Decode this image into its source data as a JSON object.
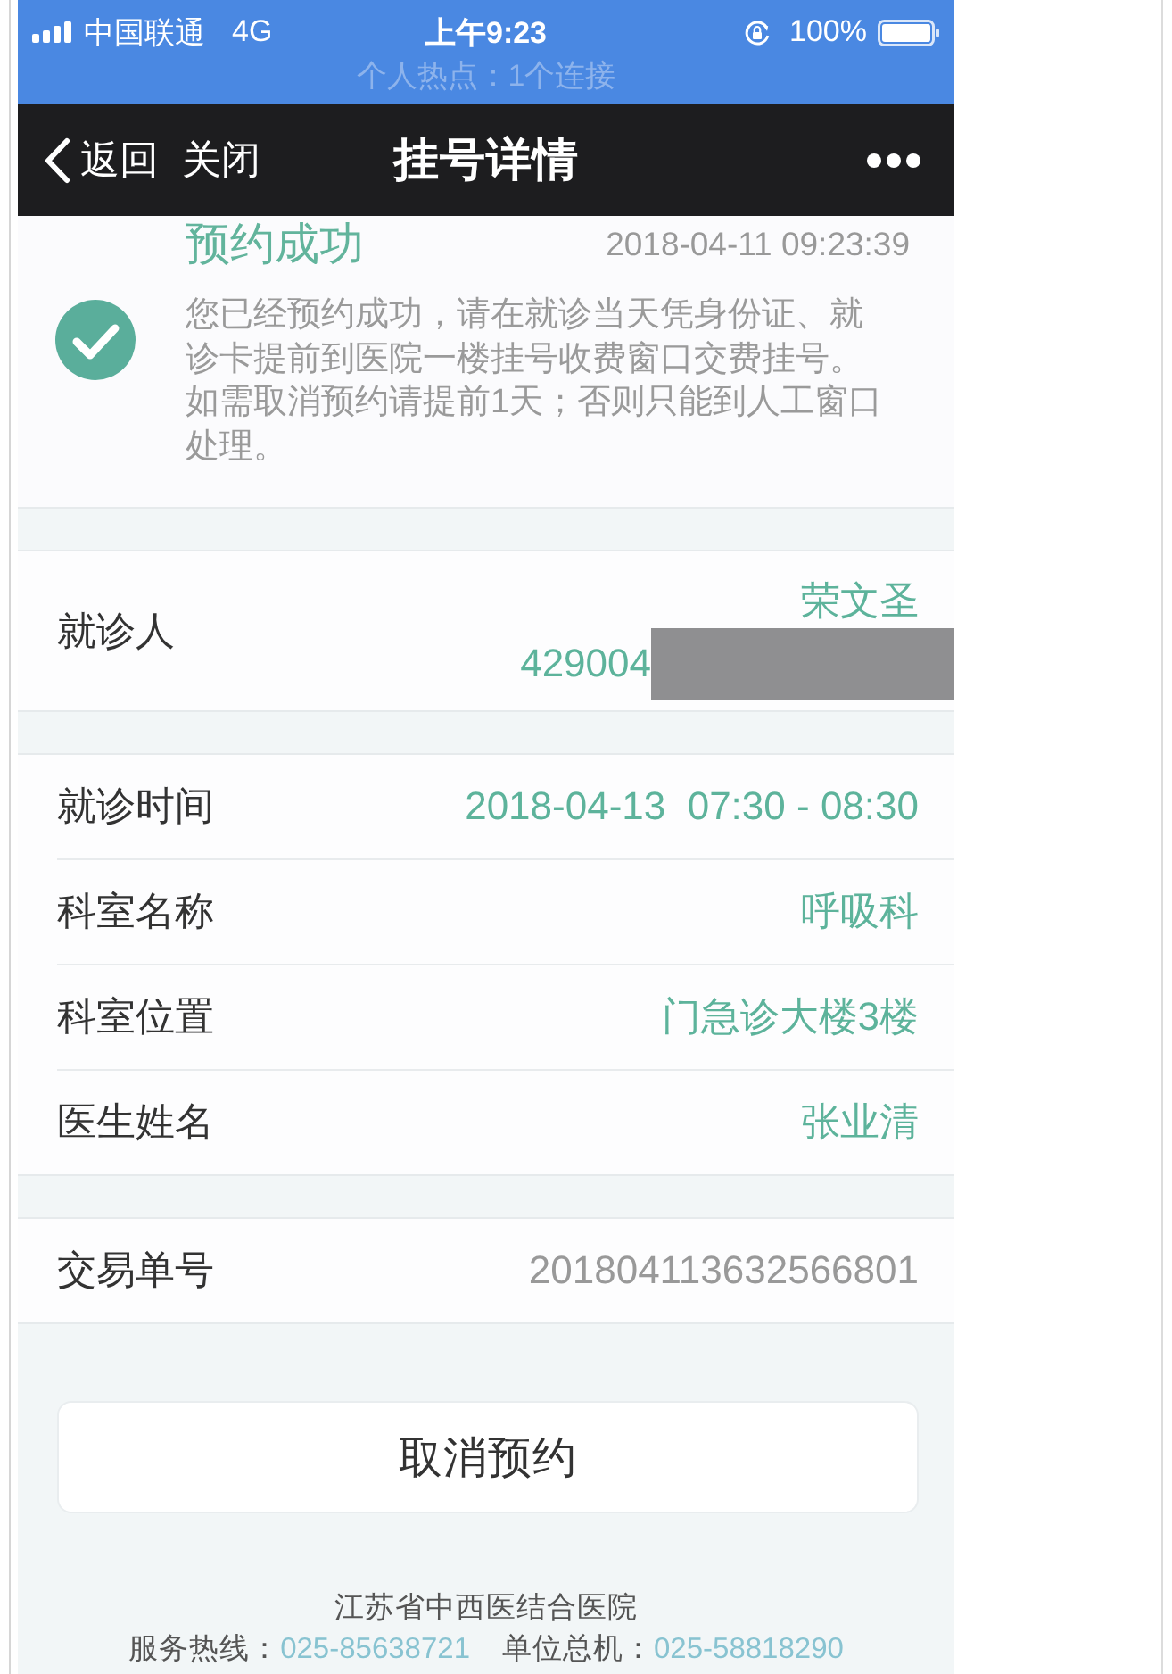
{
  "status_bar": {
    "carrier": "中国联通",
    "network": "4G",
    "time": "上午9:23",
    "battery": "100%",
    "hotspot": "个人热点：1个连接"
  },
  "nav_bar": {
    "back": "返回",
    "close": "关闭",
    "title": "挂号详情"
  },
  "result": {
    "title": "预约成功",
    "time": "2018-04-11 09:23:39",
    "message": "您已经预约成功，请在就诊当天凭身份证、就诊卡提前到医院一楼挂号收费窗口交费挂号。如需取消预约请提前1天；否则只能到人工窗口处理。"
  },
  "detail_groups": [
    {
      "rows": [
        {
          "kind": "patient",
          "label": "就诊人",
          "name": "荣文圣",
          "id_number": "429004",
          "redacted": true
        }
      ]
    },
    {
      "rows": [
        {
          "kind": "accent",
          "label": "就诊时间",
          "value": "2018-04-13  07:30 - 08:30"
        },
        {
          "kind": "accent",
          "label": "科室名称",
          "value": "呼吸科"
        },
        {
          "kind": "accent",
          "label": "科室位置",
          "value": "门急诊大楼3楼"
        },
        {
          "kind": "accent",
          "label": "医生姓名",
          "value": "张业清"
        }
      ]
    },
    {
      "rows": [
        {
          "kind": "muted",
          "label": "交易单号",
          "value": "201804113632566801"
        }
      ]
    }
  ],
  "cancel_button": {
    "label": "取消预约"
  },
  "footer": {
    "hospital": "江苏省中西医结合医院",
    "contacts": [
      {
        "label": "服务热线：",
        "number": "025-85638721"
      },
      {
        "label": "单位总机：",
        "number": "025-58818290"
      }
    ]
  }
}
